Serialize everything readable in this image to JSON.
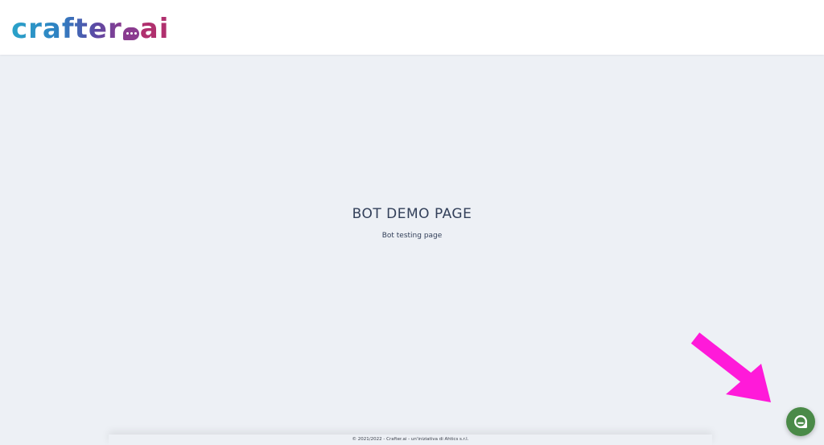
{
  "header": {
    "logo": {
      "main": "crafter",
      "suffix": "ai"
    }
  },
  "hero": {
    "title": "BOT DEMO PAGE",
    "subtitle": "Bot testing page"
  },
  "footer": {
    "text": "© 2021/2022 - Crafter.ai - un'iniziativa di Ahtics s.r.l."
  },
  "chat_launcher": {
    "icon": "chat-bubble-icon",
    "color": "#4a8a48"
  },
  "annotation": {
    "arrow_color": "#ff1ad9"
  },
  "colors": {
    "background": "#edf0f5",
    "header": "#ffffff",
    "text": "#33405a"
  }
}
